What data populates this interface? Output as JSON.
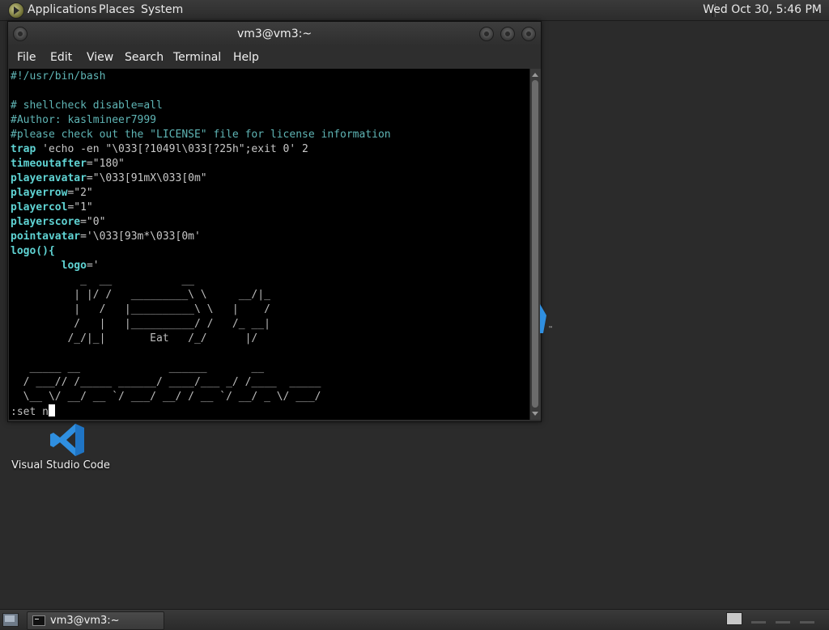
{
  "top_panel": {
    "menus": [
      "Applications",
      "Places",
      "System"
    ],
    "clock": "Wed Oct 30,  5:46 PM"
  },
  "window": {
    "title": "vm3@vm3:~",
    "menus": [
      "File",
      "Edit",
      "View",
      "Search",
      "Terminal",
      "Help"
    ]
  },
  "terminal": {
    "lines": [
      [
        {
          "t": "#!/usr/bin/bash",
          "c": "com"
        }
      ],
      [],
      [
        {
          "t": "# shellcheck disable=all",
          "c": "com"
        }
      ],
      [
        {
          "t": "#Author: kaslmineer7999",
          "c": "com"
        }
      ],
      [
        {
          "t": "#please check out the \"LICENSE\" file for license information",
          "c": "com"
        }
      ],
      [
        {
          "t": "trap",
          "c": "kw"
        },
        {
          "t": " 'echo -en \"\\033[?1049l\\033[?25h\";exit 0' 2",
          "c": "str"
        }
      ],
      [
        {
          "t": "timeoutafter",
          "c": "kw"
        },
        {
          "t": "=\"180\"",
          "c": "str"
        }
      ],
      [
        {
          "t": "playeravatar",
          "c": "kw"
        },
        {
          "t": "=\"\\033[91mX\\033[0m\"",
          "c": "str"
        }
      ],
      [
        {
          "t": "playerrow",
          "c": "kw"
        },
        {
          "t": "=\"2\"",
          "c": "str"
        }
      ],
      [
        {
          "t": "playercol",
          "c": "kw"
        },
        {
          "t": "=\"1\"",
          "c": "str"
        }
      ],
      [
        {
          "t": "playerscore",
          "c": "kw"
        },
        {
          "t": "=\"0\"",
          "c": "str"
        }
      ],
      [
        {
          "t": "pointavatar",
          "c": "kw"
        },
        {
          "t": "='\\033[93m*\\033[0m'",
          "c": "str"
        }
      ],
      [
        {
          "t": "logo(){",
          "c": "kw"
        }
      ],
      [
        {
          "t": "        ",
          "c": "txt"
        },
        {
          "t": "logo",
          "c": "kw"
        },
        {
          "t": "='",
          "c": "str"
        }
      ],
      [
        {
          "t": "           _  __           __",
          "c": "txt"
        }
      ],
      [
        {
          "t": "          | |/ /   _________\\ \\     __/|_",
          "c": "txt"
        }
      ],
      [
        {
          "t": "          |   /   |__________\\ \\   |    /",
          "c": "txt"
        }
      ],
      [
        {
          "t": "          /   |   |__________/ /   /_ __|",
          "c": "txt"
        }
      ],
      [
        {
          "t": "         /_/|_|       Eat   /_/      |/",
          "c": "txt"
        }
      ],
      [],
      [
        {
          "t": "   _____ __              ______       __",
          "c": "txt"
        }
      ],
      [
        {
          "t": "  / ___// /_____ ______/ ____/___ _/ /____  _____",
          "c": "txt"
        }
      ],
      [
        {
          "t": "  \\__ \\/ __/ __ `/ ___/ __/ / __ `/ __/ _ \\/ ___/",
          "c": "txt"
        }
      ]
    ],
    "command": ":set n"
  },
  "desktop": {
    "icon_label": "Visual Studio Code"
  },
  "taskbar": {
    "task_label": "vm3@vm3:~"
  },
  "colors": {
    "comment": "#5fb5b5",
    "keyword": "#5fd3d3",
    "background": "#000000",
    "vscode_blue": "#2f8fe0"
  }
}
